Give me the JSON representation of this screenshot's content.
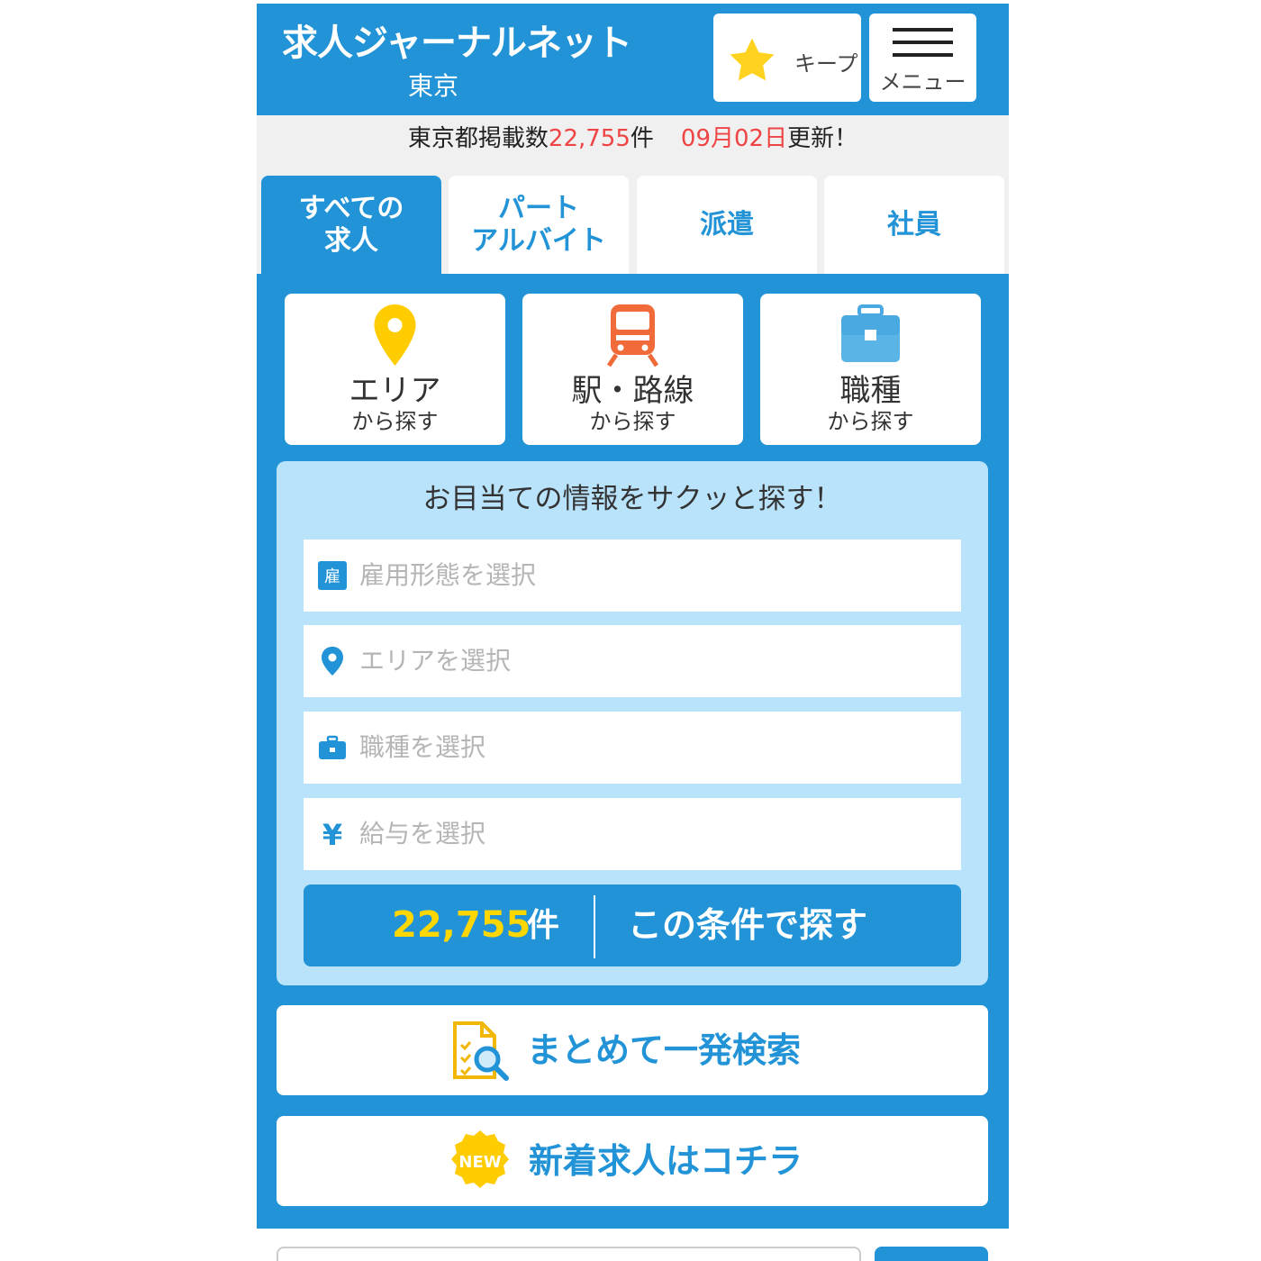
{
  "header": {
    "site_title": "求人ジャーナルネット",
    "region": "東京",
    "keep_label": "キープ",
    "menu_label": "メニュー"
  },
  "info": {
    "prefix": "東京都掲載数",
    "count": "22,755",
    "count_unit": "件",
    "date": "09月02日",
    "suffix": "更新！"
  },
  "tabs": [
    {
      "label_line1": "すべての",
      "label_line2": "求人",
      "active": true
    },
    {
      "label_line1": "パート",
      "label_line2": "アルバイト",
      "active": false
    },
    {
      "label_line1": "派遣",
      "label_line2": "",
      "active": false
    },
    {
      "label_line1": "社員",
      "label_line2": "",
      "active": false
    }
  ],
  "categories": [
    {
      "title": "エリア",
      "sub": "から探す",
      "icon": "map-pin-icon"
    },
    {
      "title": "駅・路線",
      "sub": "から探す",
      "icon": "train-icon"
    },
    {
      "title": "職種",
      "sub": "から探す",
      "icon": "briefcase-icon"
    }
  ],
  "search": {
    "title": "お目当ての情報をサクッと探す！",
    "fields": [
      {
        "placeholder": "雇用形態を選択",
        "icon": "employment-type-icon"
      },
      {
        "placeholder": "エリアを選択",
        "icon": "map-pin-icon"
      },
      {
        "placeholder": "職種を選択",
        "icon": "briefcase-icon"
      },
      {
        "placeholder": "給与を選択",
        "icon": "yen-icon"
      }
    ],
    "result_count": "22,755",
    "result_unit": "件",
    "submit_label": "この条件で探す"
  },
  "bulk_search_label": "まとめて一発検索",
  "new_jobs": {
    "badge": "NEW",
    "label": "新着求人はコチラ"
  },
  "colors": {
    "primary": "#2193d6",
    "panel": "#b8e3fb",
    "accent_yellow": "#ffd700",
    "red": "#ee4444"
  }
}
